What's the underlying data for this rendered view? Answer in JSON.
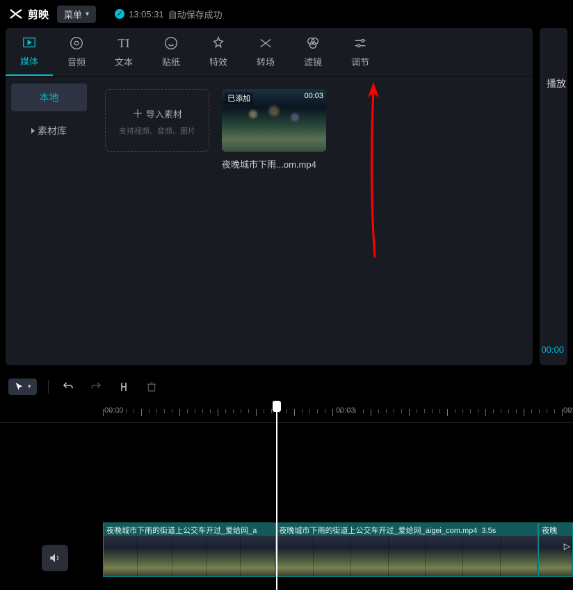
{
  "app": {
    "name": "剪映"
  },
  "header": {
    "menu_label": "菜单",
    "autosave_time": "13:05:31",
    "autosave_text": "自动保存成功"
  },
  "toolbar": {
    "items": [
      {
        "label": "媒体",
        "icon": "media"
      },
      {
        "label": "音频",
        "icon": "audio"
      },
      {
        "label": "文本",
        "icon": "text"
      },
      {
        "label": "贴纸",
        "icon": "sticker"
      },
      {
        "label": "特效",
        "icon": "effects"
      },
      {
        "label": "转场",
        "icon": "transition"
      },
      {
        "label": "滤镜",
        "icon": "filter"
      },
      {
        "label": "调节",
        "icon": "adjust"
      }
    ],
    "active": 0
  },
  "sidebar": {
    "local": "本地",
    "library": "素材库"
  },
  "import": {
    "title": "导入素材",
    "subtitle": "支持视频、音频、图片"
  },
  "clip": {
    "badge": "已添加",
    "duration": "00:03",
    "name": "夜晚城市下雨...om.mp4"
  },
  "right": {
    "label": "播放",
    "time": "00:00"
  },
  "timeline": {
    "ticks": [
      "00:00",
      "00:03",
      "00:"
    ],
    "clip1_label": "夜晚城市下雨的街道上公交车开过_爱给网_a",
    "clip2_label": "夜晚城市下雨的街道上公交车开过_爱给网_aigei_com.mp4",
    "clip2_dur": "3.5s",
    "clip3_label": "夜晚"
  }
}
